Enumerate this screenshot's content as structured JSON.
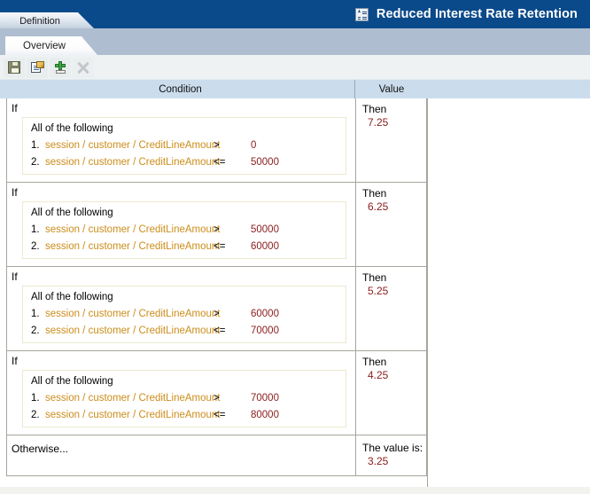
{
  "header": {
    "title": "Reduced Interest Rate Retention",
    "icon": "ruleset-icon",
    "background_color": "#0a4a8a",
    "text_color": "#ffffff"
  },
  "tabs": {
    "outer": [
      {
        "label": "Definition",
        "selected": true
      }
    ],
    "inner": [
      {
        "label": "Overview",
        "selected": true
      }
    ]
  },
  "toolbar": {
    "buttons": [
      {
        "name": "save-button",
        "icon": "save-icon",
        "enabled": true
      },
      {
        "name": "edit-properties-button",
        "icon": "edit-properties-icon",
        "enabled": true
      },
      {
        "name": "add-row-button",
        "icon": "add-icon",
        "enabled": true
      },
      {
        "name": "delete-row-button",
        "icon": "close-icon",
        "enabled": false
      }
    ]
  },
  "table": {
    "columns": [
      {
        "key": "condition",
        "label": "Condition"
      },
      {
        "key": "value",
        "label": "Value"
      }
    ],
    "colors": {
      "header_background": "#cbdcec",
      "path_text": "#cc8d1a",
      "value_text": "#8c2020",
      "grid_border": "#a3a79b",
      "condition_box_border": "#ece9cf"
    },
    "rows": [
      {
        "if_label": "If",
        "condition_title": "All of the following",
        "conditions": [
          {
            "num": "1.",
            "path": "session / customer / CreditLineAmount",
            "operator": ">",
            "value": "0"
          },
          {
            "num": "2.",
            "path": "session / customer / CreditLineAmount",
            "operator": "<=",
            "value": "50000"
          }
        ],
        "then_label": "Then",
        "then_value": "7.25"
      },
      {
        "if_label": "If",
        "condition_title": "All of the following",
        "conditions": [
          {
            "num": "1.",
            "path": "session / customer / CreditLineAmount",
            "operator": ">",
            "value": "50000"
          },
          {
            "num": "2.",
            "path": "session / customer / CreditLineAmount",
            "operator": "<=",
            "value": "60000"
          }
        ],
        "then_label": "Then",
        "then_value": "6.25"
      },
      {
        "if_label": "If",
        "condition_title": "All of the following",
        "conditions": [
          {
            "num": "1.",
            "path": "session / customer / CreditLineAmount",
            "operator": ">",
            "value": "60000"
          },
          {
            "num": "2.",
            "path": "session / customer / CreditLineAmount",
            "operator": "<=",
            "value": "70000"
          }
        ],
        "then_label": "Then",
        "then_value": "5.25"
      },
      {
        "if_label": "If",
        "condition_title": "All of the following",
        "conditions": [
          {
            "num": "1.",
            "path": "session / customer / CreditLineAmount",
            "operator": ">",
            "value": "70000"
          },
          {
            "num": "2.",
            "path": "session / customer / CreditLineAmount",
            "operator": "<=",
            "value": "80000"
          }
        ],
        "then_label": "Then",
        "then_value": "4.25"
      }
    ],
    "otherwise": {
      "label": "Otherwise...",
      "value_label": "The value is:",
      "value": "3.25"
    }
  }
}
